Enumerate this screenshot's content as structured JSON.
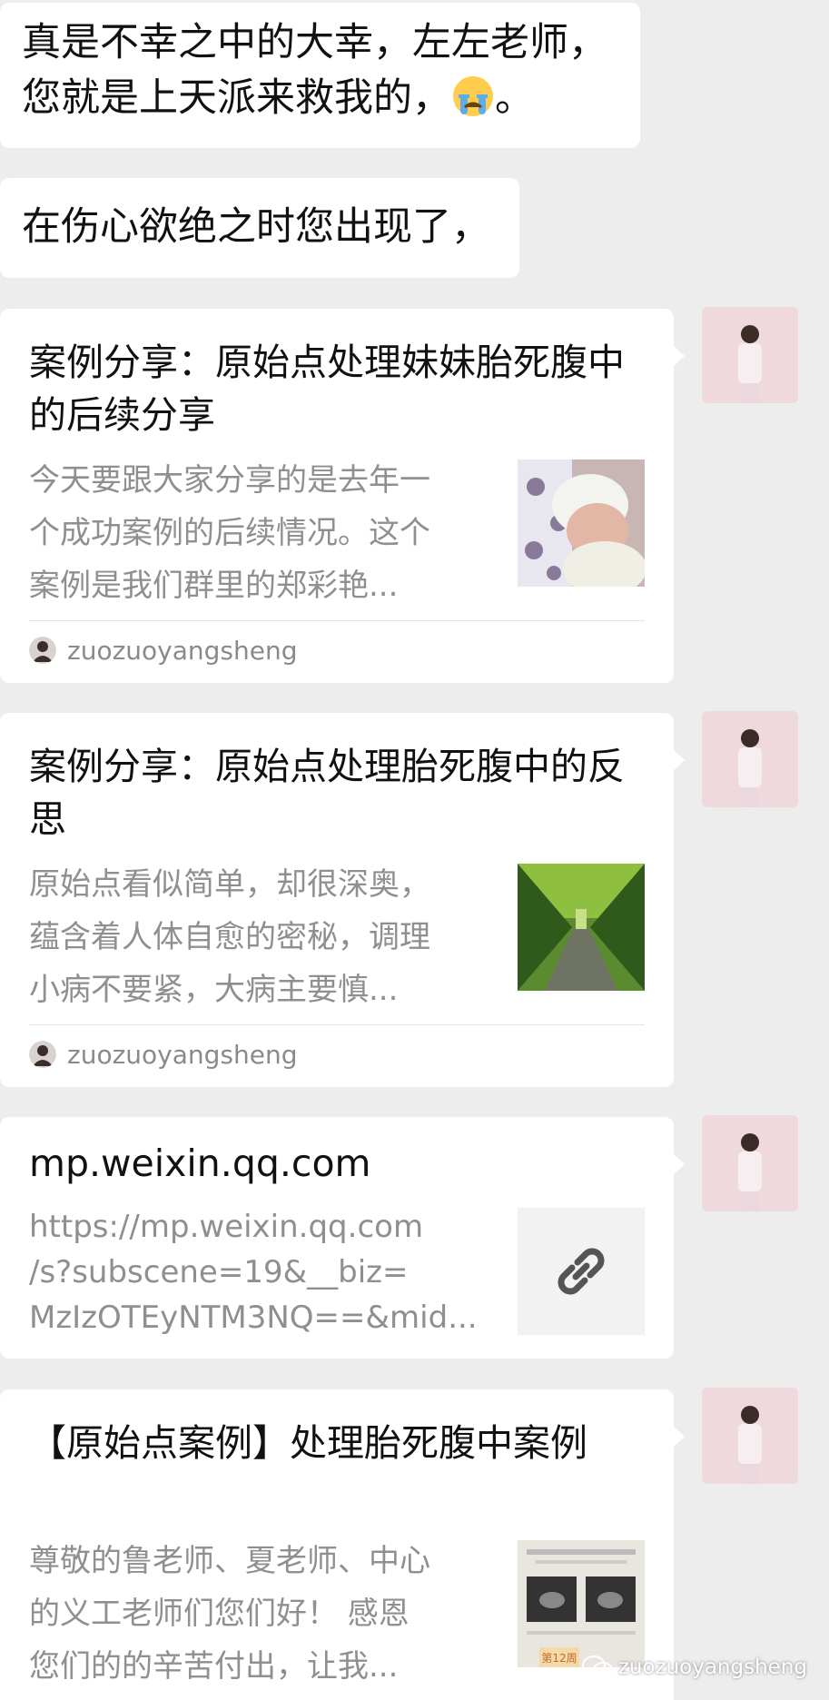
{
  "messages": [
    {
      "text_line1": "真是不幸之中的大幸，左左老师，",
      "text_line2_before": "您就是上天派来救我的，",
      "text_line2_after": "。",
      "emoji": "crying-face-icon"
    },
    {
      "text": "在伤心欲绝之时您出现了，"
    }
  ],
  "cards": [
    {
      "title": "案例分享：原始点处理妹妹胎死腹中的后续分享",
      "description": "今天要跟大家分享的是去年一\n个成功案例的后续情况。这个\n案例是我们群里的郑彩艳...",
      "source": "zuozuoyangsheng",
      "thumb": "baby-photo"
    },
    {
      "title": "案例分享：原始点处理胎死腹中的反思",
      "description": "原始点看似简单，却很深奥，\n蕴含着人体自愈的密秘，调理\n小病不要紧，大病主要慎...",
      "source": "zuozuoyangsheng",
      "thumb": "tree-road-photo"
    },
    {
      "title": "mp.weixin.qq.com",
      "description": "https://mp.weixin.qq.com\n/s?subscene=19&__biz=\nMzIzOTEyNTM3NQ==&mid...",
      "thumb": "link-icon"
    },
    {
      "title": "【原始点案例】处理胎死腹中案例",
      "description": "尊敬的鲁老师、夏老师、中心\n的义工老师们您们好！ 感恩\n您们的的辛苦付出，让我...",
      "thumb": "ultrasound-report-photo",
      "thumb_caption": "第12周"
    }
  ],
  "watermark": {
    "text": "zuozuoyangsheng"
  },
  "colors": {
    "background": "#ededed",
    "bubble": "#ffffff",
    "secondary_text": "#8f8f8f"
  }
}
